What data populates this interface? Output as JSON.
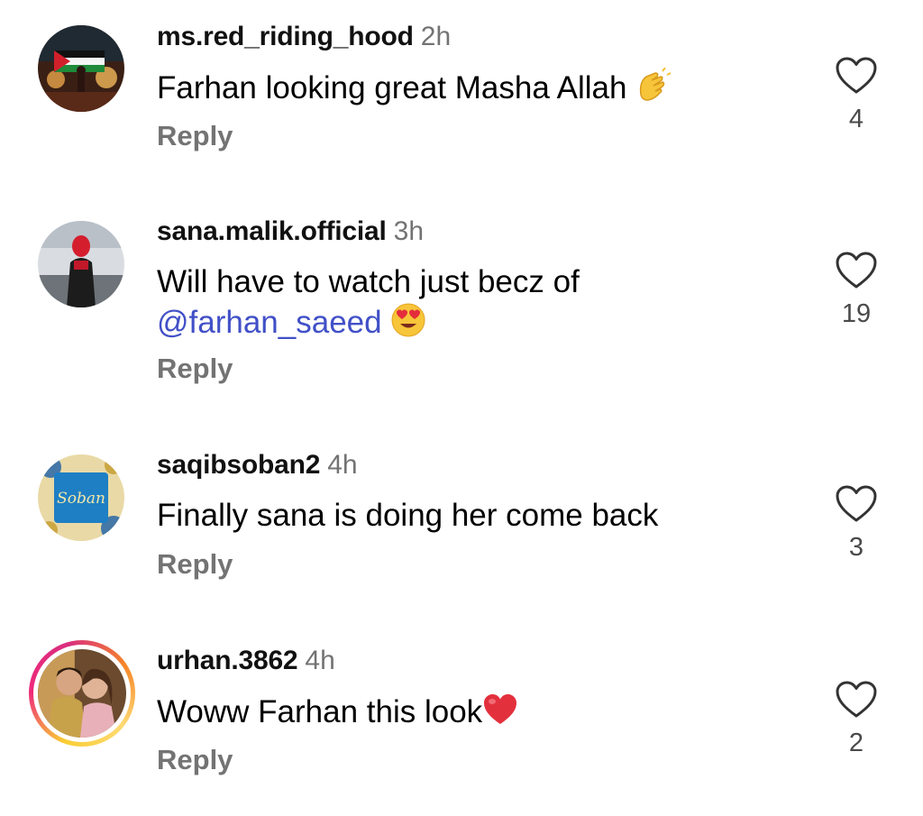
{
  "comments": [
    {
      "username": "ms.red_riding_hood",
      "time": "2h",
      "text": "Farhan looking great Masha Allah",
      "emoji": "clapping-hands-emoji",
      "reply": "Reply",
      "likes": "4"
    },
    {
      "username": "sana.malik.official",
      "time": "3h",
      "text_line1": "Will have to watch just becz of",
      "mention": "@farhan_saeed",
      "emoji": "heart-eyes-emoji",
      "reply": "Reply",
      "likes": "19"
    },
    {
      "username": "saqibsoban2",
      "time": "4h",
      "text": "Finally sana is doing her come back",
      "reply": "Reply",
      "likes": "3",
      "avatar_text": "Soban"
    },
    {
      "username": "urhan.3862",
      "time": "4h",
      "text": "Woww Farhan this look",
      "emoji": "red-heart-emoji",
      "reply": "Reply",
      "likes": "2"
    }
  ],
  "colors": {
    "username": "#111111",
    "meta": "#737373",
    "mention": "#4150c7",
    "like_count": "#4a4a4a"
  }
}
